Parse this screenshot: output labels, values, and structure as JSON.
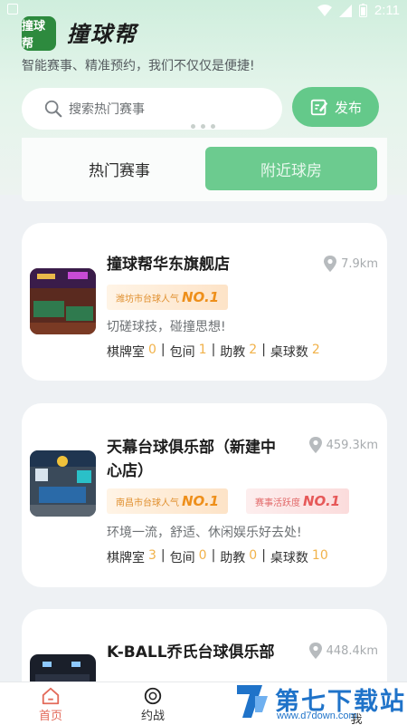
{
  "status_bar": {
    "time": "2:11"
  },
  "app": {
    "logo_text": "撞球帮",
    "title": "撞球帮",
    "tagline": "智能赛事、精准预约，我们不仅仅是便捷!"
  },
  "search": {
    "placeholder": "搜索热门赛事"
  },
  "publish": {
    "label": "发布"
  },
  "tabs": [
    {
      "label": "热门赛事"
    },
    {
      "label": "附近球房"
    }
  ],
  "venues": [
    {
      "name": "撞球帮华东旗舰店",
      "distance": "7.9km",
      "badges": [
        {
          "text": "潍坊市台球人气",
          "rank": "NO.1",
          "style": "orange"
        }
      ],
      "description": "切磋球技，碰撞思想!",
      "stats": [
        {
          "label": "棋牌室",
          "value": "0"
        },
        {
          "label": "包间",
          "value": "1"
        },
        {
          "label": "助教",
          "value": "2"
        },
        {
          "label": "桌球数",
          "value": "2"
        }
      ]
    },
    {
      "name_line1": "天幕台球俱乐部（新建中",
      "name_line2": "心店）",
      "distance": "459.3km",
      "badges": [
        {
          "text": "南昌市台球人气",
          "rank": "NO.1",
          "style": "orange"
        },
        {
          "text": "赛事活跃度",
          "rank": "NO.1",
          "style": "pink"
        }
      ],
      "description": "环境一流，舒适、休闲娱乐好去处!",
      "stats": [
        {
          "label": "棋牌室",
          "value": "3"
        },
        {
          "label": "包间",
          "value": "0"
        },
        {
          "label": "助教",
          "value": "0"
        },
        {
          "label": "桌球数",
          "value": "10"
        }
      ]
    },
    {
      "name": "K-BALL乔氏台球俱乐部",
      "distance": "448.4km"
    }
  ],
  "bottom_nav": [
    {
      "label": "首页"
    },
    {
      "label": "约战"
    },
    {
      "label": "我"
    }
  ],
  "watermark": {
    "title": "第七下载站",
    "url": "www.d7down.com"
  },
  "colors": {
    "accent_green": "#64c98a",
    "home_active": "#e36a5a",
    "rank_orange": "#ee8f1a",
    "rank_red": "#e65858"
  }
}
